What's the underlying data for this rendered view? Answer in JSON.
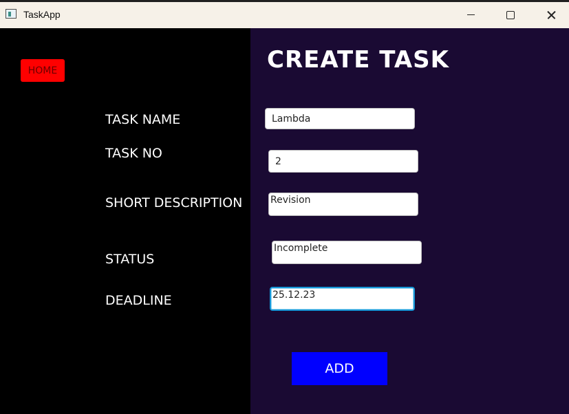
{
  "window": {
    "title": "TaskApp"
  },
  "sidebar": {
    "home_label": "HOME"
  },
  "form": {
    "title": "CREATE TASK",
    "fields": [
      {
        "label": "TASK NAME",
        "value": "Lambda"
      },
      {
        "label": "TASK NO",
        "value": "2"
      },
      {
        "label": "SHORT DESCRIPTION",
        "value": "Revision"
      },
      {
        "label": "STATUS",
        "value": "Incomplete"
      },
      {
        "label": "DEADLINE",
        "value": "25.12.23"
      }
    ],
    "submit_label": "ADD"
  },
  "colors": {
    "left_background": "#000000",
    "right_background": "#1a0a33",
    "home_button": "#ff0000",
    "add_button": "#0000ff",
    "focus_border": "#1697d7"
  }
}
